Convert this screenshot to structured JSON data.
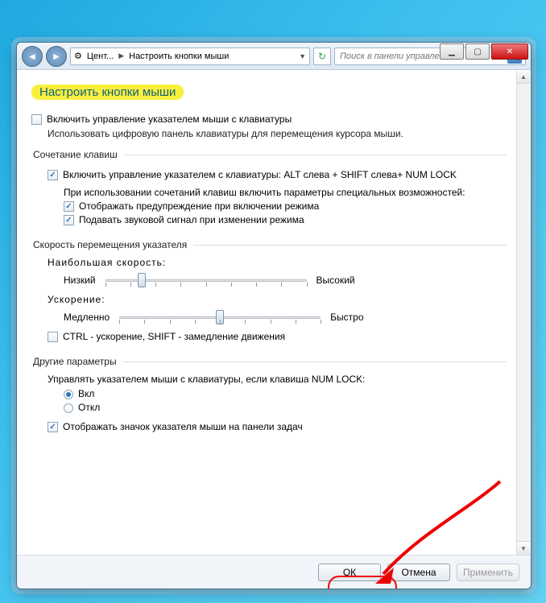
{
  "window": {
    "min_tooltip": "Свернуть",
    "max_tooltip": "Развернуть",
    "close_tooltip": "Закрыть"
  },
  "toolbar": {
    "back_tooltip": "Назад",
    "forward_tooltip": "Вперёд",
    "address_seg1": "Цент...",
    "address_seg2": "Настроить кнопки мыши",
    "refresh_tooltip": "Обновить",
    "search_placeholder": "Поиск в панели управления"
  },
  "page": {
    "heading": "Настроить кнопки мыши",
    "enable_mousekeys_label": "Включить управление указателем мыши с клавиатуры",
    "enable_mousekeys_checked": false,
    "description": "Использовать цифровую панель клавиатуры для перемещения курсора мыши."
  },
  "shortcut": {
    "legend": "Сочетание клавиш",
    "enable_shortcut_label": "Включить управление указателем с клавиатуры: ALT слева + SHIFT слева+ NUM LOCK",
    "enable_shortcut_checked": true,
    "subdesc": "При использовании сочетаний клавиш включить параметры специальных возможностей:",
    "warn_label": "Отображать предупреждение при включении режима",
    "warn_checked": true,
    "sound_label": "Подавать звуковой сигнал при изменении режима",
    "sound_checked": true
  },
  "pointer": {
    "legend": "Скорость перемещения указателя",
    "topspeed_label": "Наибольшая скорость:",
    "topspeed_low": "Низкий",
    "topspeed_high": "Высокий",
    "topspeed_value": 18,
    "accel_label": "Ускорение:",
    "accel_low": "Медленно",
    "accel_high": "Быстро",
    "accel_value": 50,
    "ctrlshift_label": "CTRL - ускорение, SHIFT - замедление движения",
    "ctrlshift_checked": false
  },
  "other": {
    "legend": "Другие параметры",
    "numlock_desc": "Управлять указателем мыши с клавиатуры, если клавиша NUM LOCK:",
    "on_label": "Вкл",
    "off_label": "Откл",
    "selected": "on",
    "trayicon_label": "Отображать значок указателя мыши на панели задач",
    "trayicon_checked": true
  },
  "buttons": {
    "ok": "ОК",
    "cancel": "Отмена",
    "apply": "Применить"
  }
}
